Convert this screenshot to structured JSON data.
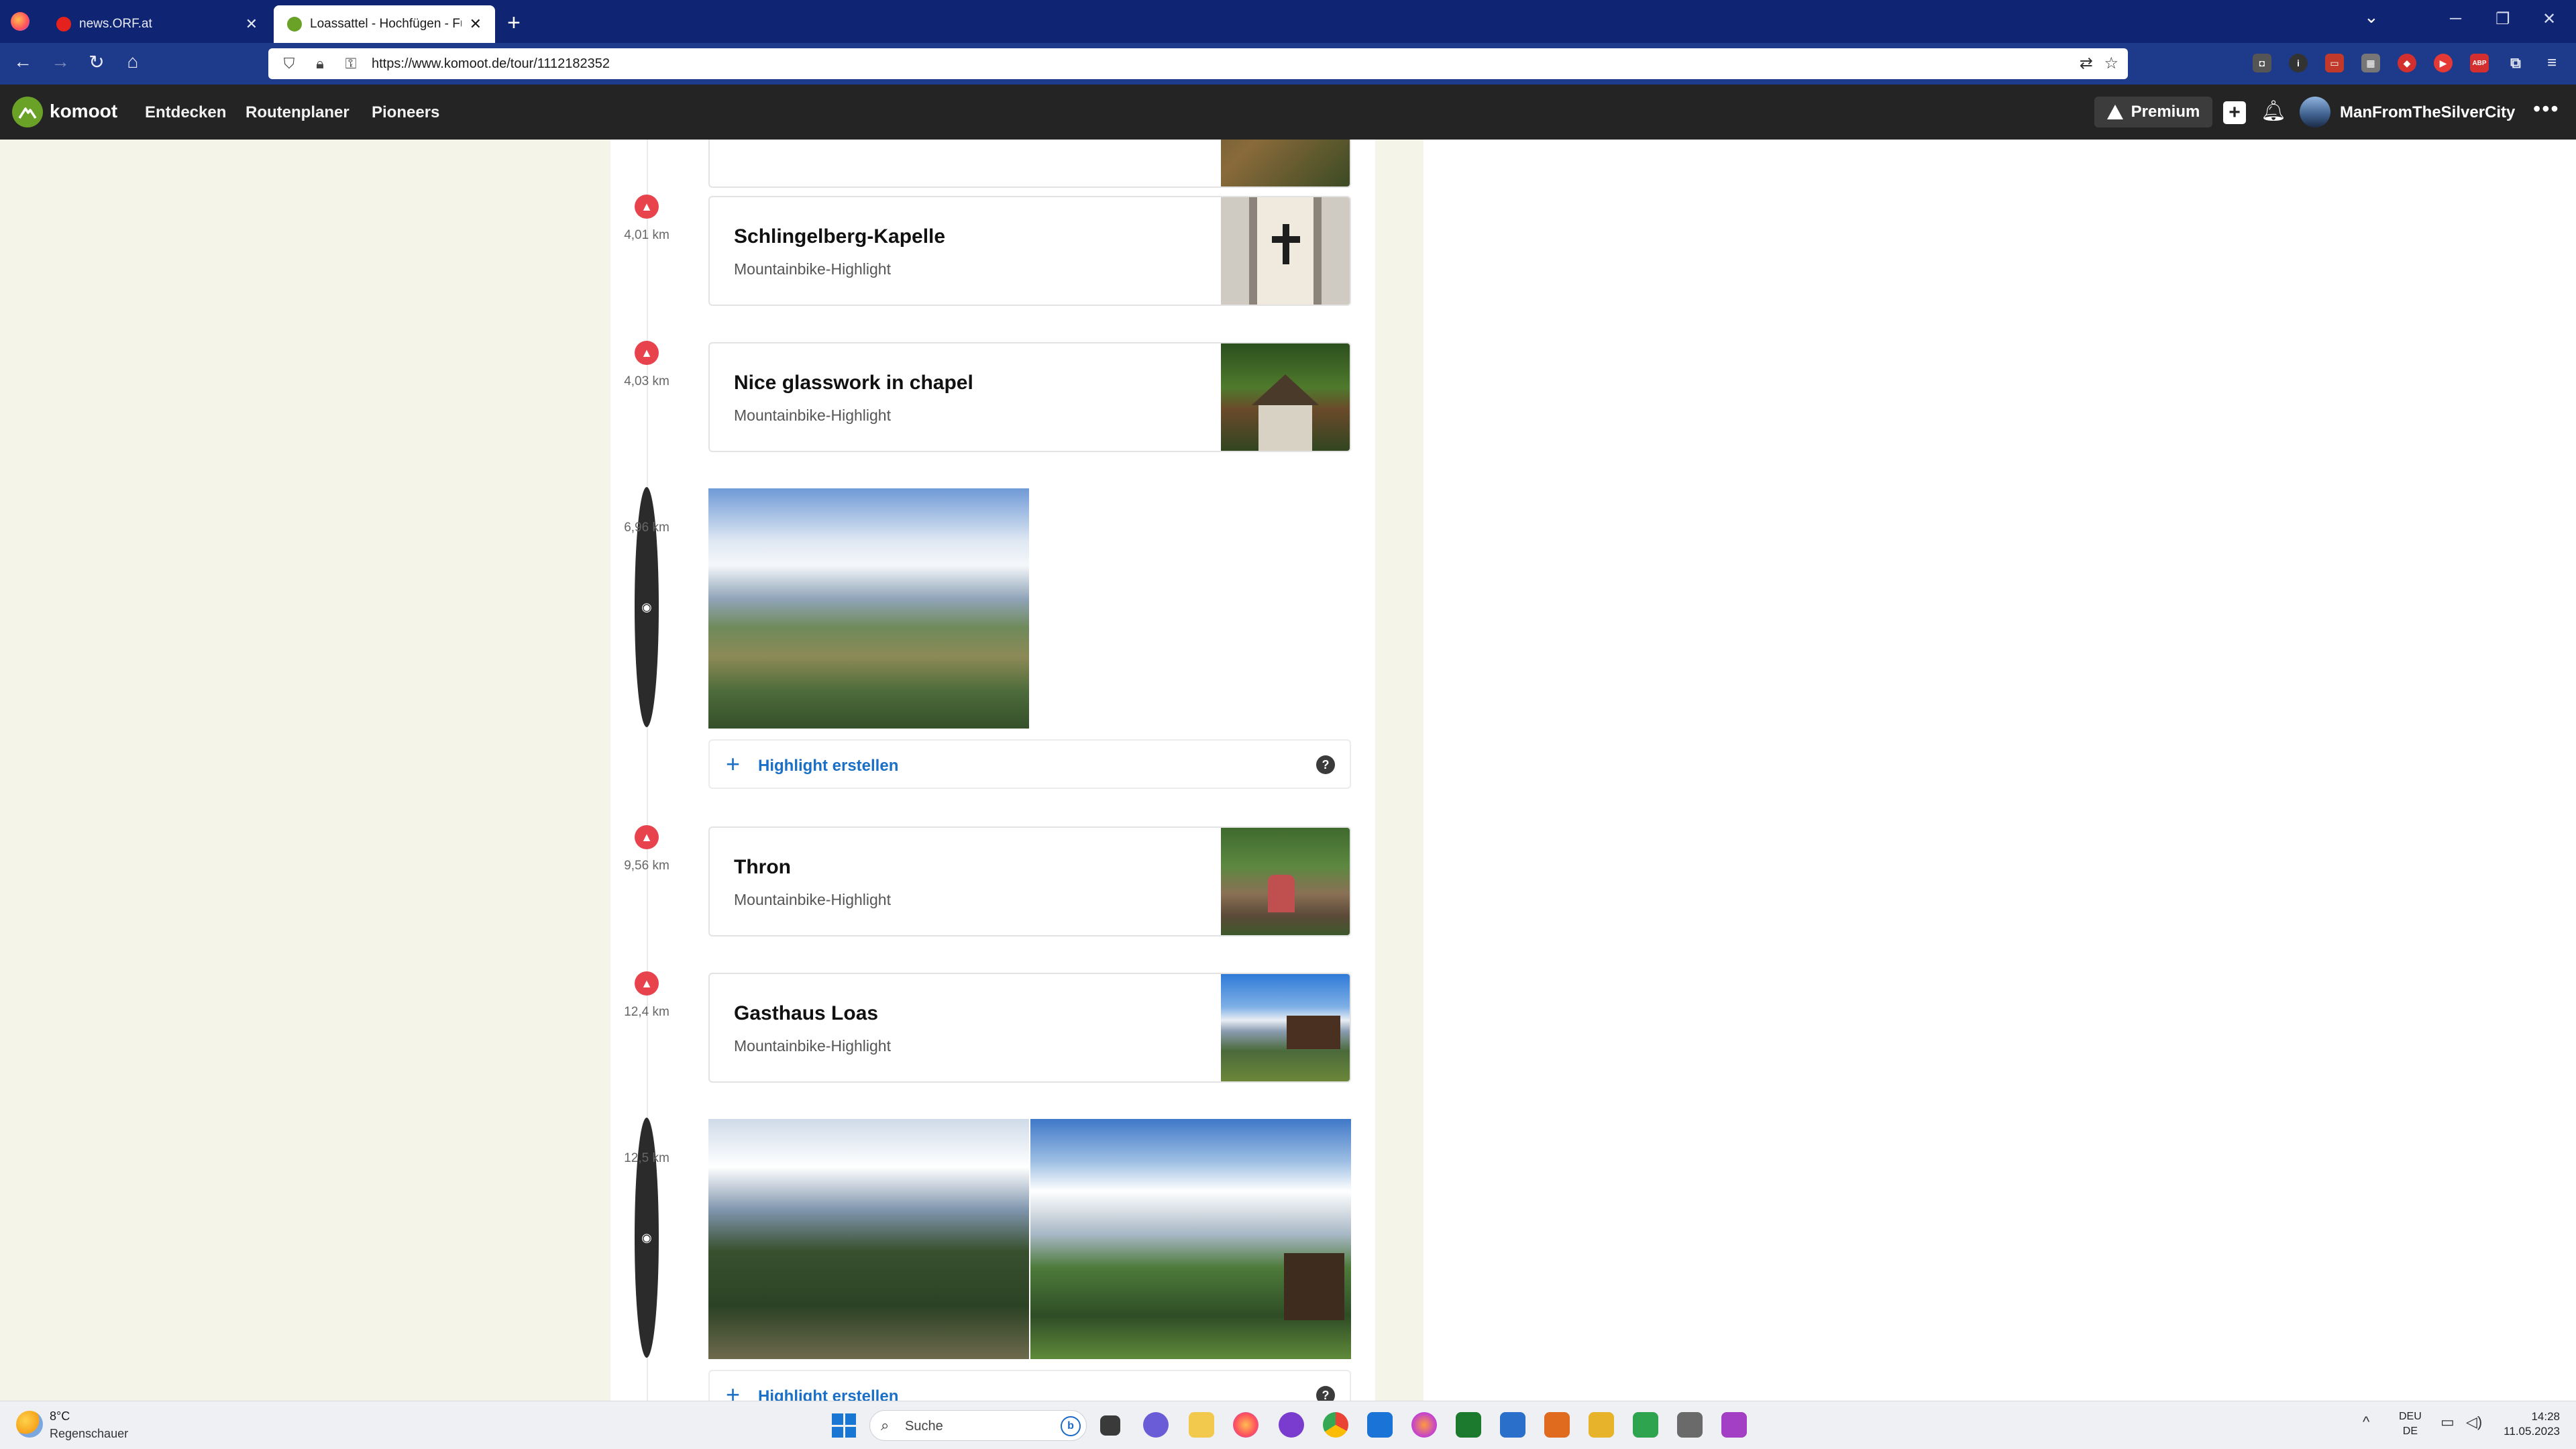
{
  "browser": {
    "tabs": [
      {
        "title": "news.ORF.at",
        "favicon_color": "#e5211d"
      },
      {
        "title": "Loassattel - Hochfügen - Fügen",
        "favicon_color": "#6aa127"
      }
    ],
    "new_tab_label": "+",
    "url": "https://www.komoot.de/tour/1112182352",
    "window_controls": [
      "─",
      "❐",
      "✕"
    ]
  },
  "komoot": {
    "brand": "komoot",
    "nav": [
      "Entdecken",
      "Routenplaner",
      "Pioneers"
    ],
    "premium_label": "Premium",
    "username": "ManFromTheSilverCity",
    "more_label": "•••"
  },
  "timeline": {
    "highlights": [
      {
        "distance": "4,01 km",
        "title": "Schlingelberg-Kapelle",
        "subtitle": "Mountainbike-Highlight"
      },
      {
        "distance": "4,03 km",
        "title": "Nice glasswork in chapel",
        "subtitle": "Mountainbike-Highlight"
      },
      {
        "distance": "9,56 km",
        "title": "Thron",
        "subtitle": "Mountainbike-Highlight"
      },
      {
        "distance": "12,4 km",
        "title": "Gasthaus Loas",
        "subtitle": "Mountainbike-Highlight"
      }
    ],
    "photos": [
      {
        "distance": "6,96 km"
      },
      {
        "distance": "12,5 km"
      }
    ],
    "create_highlight_label": "Highlight erstellen",
    "help_label": "?"
  },
  "taskbar": {
    "weather_temp": "8°C",
    "weather_desc": "Regenschauer",
    "search_label": "Suche",
    "lang_line1": "DEU",
    "lang_line2": "DE",
    "time": "14:28",
    "date": "11.05.2023"
  }
}
